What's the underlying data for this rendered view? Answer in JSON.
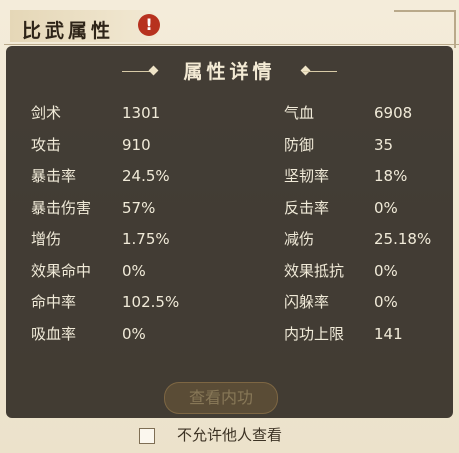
{
  "page": {
    "title": "比武属性",
    "title_mark": "!",
    "privacy_label": "不允许他人查看"
  },
  "overlay": {
    "title": "属性详情",
    "button_label": "查看内功"
  },
  "stats": [
    {
      "left_label": "剑术",
      "left_value": "1301",
      "right_label": "气血",
      "right_value": "6908"
    },
    {
      "left_label": "攻击",
      "left_value": "910",
      "right_label": "防御",
      "right_value": "35"
    },
    {
      "left_label": "暴击率",
      "left_value": "24.5%",
      "right_label": "坚韧率",
      "right_value": "18%"
    },
    {
      "left_label": "暴击伤害",
      "left_value": "57%",
      "right_label": "反击率",
      "right_value": "0%"
    },
    {
      "left_label": "增伤",
      "left_value": "1.75%",
      "right_label": "减伤",
      "right_value": "25.18%"
    },
    {
      "left_label": "效果命中",
      "left_value": "0%",
      "right_label": "效果抵抗",
      "right_value": "0%"
    },
    {
      "left_label": "命中率",
      "left_value": "102.5%",
      "right_label": "闪躲率",
      "right_value": "0%"
    },
    {
      "left_label": "吸血率",
      "left_value": "0%",
      "right_label": "内功上限",
      "right_value": "141"
    }
  ],
  "colors": {
    "overlay_bg": "#16120c",
    "text": "#f0ead8",
    "page_bg": "#efe6d2",
    "accent": "#b7321f"
  }
}
